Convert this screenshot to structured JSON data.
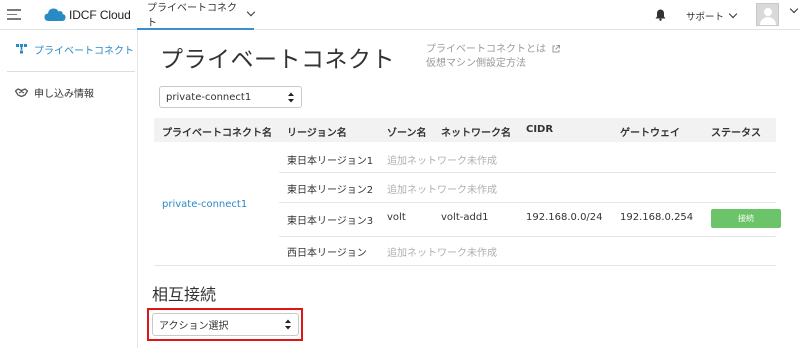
{
  "header": {
    "app_name": "IDCF Cloud",
    "nav_tab": "プライベートコネクト",
    "support_label": "サポート"
  },
  "sidebar": {
    "items": [
      {
        "label": "プライベートコネクト",
        "icon": "network-icon",
        "active": true
      },
      {
        "label": "申し込み情報",
        "icon": "handshake-icon",
        "active": false
      }
    ]
  },
  "main": {
    "title": "プライベートコネクト",
    "help_links": [
      "プライベートコネクトとは",
      "仮想マシン側設定方法"
    ],
    "connection_select": "private-connect1",
    "table": {
      "headers": [
        "プライベートコネクト名",
        "リージョン名",
        "ゾーン名",
        "ネットワーク名",
        "CIDR",
        "ゲートウェイ",
        "ステータス"
      ],
      "connection_name": "private-connect1",
      "rows": [
        {
          "region": "東日本リージョン1",
          "note": "追加ネットワーク未作成"
        },
        {
          "region": "東日本リージョン2",
          "note": "追加ネットワーク未作成"
        },
        {
          "region": "東日本リージョン3",
          "zone": "volt",
          "network": "volt-add1",
          "cidr": "192.168.0.0/24",
          "gateway": "192.168.0.254",
          "status": "接続"
        },
        {
          "region": "西日本リージョン",
          "note": "追加ネットワーク未作成"
        }
      ]
    },
    "interconnect": {
      "title": "相互接続",
      "action_select": "アクション選択"
    }
  },
  "colors": {
    "accent": "#2a8ac6",
    "status_connected": "#6bc46a",
    "highlight": "#e01515"
  }
}
